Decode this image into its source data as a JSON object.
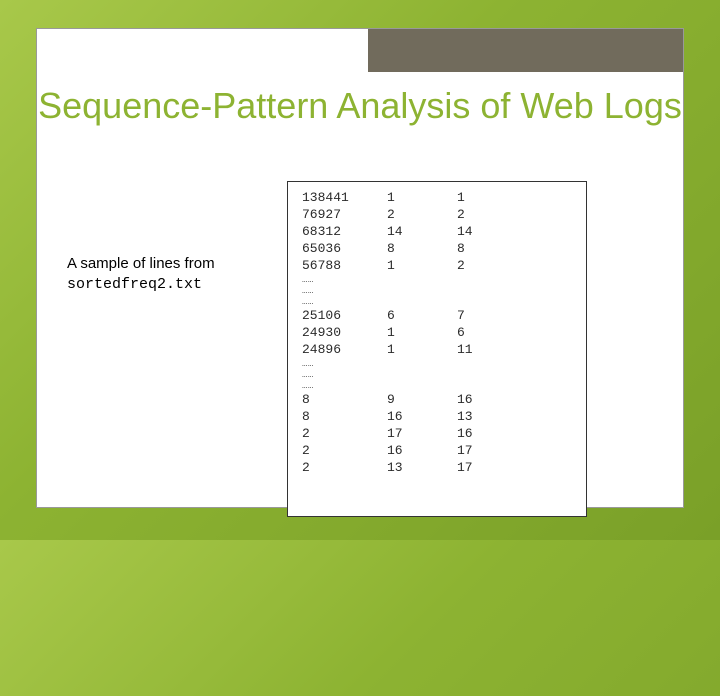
{
  "title": "Sequence-Pattern Analysis of Web Logs",
  "caption_line1": "A sample of lines from",
  "caption_filename": "sortedfreq2.txt",
  "ellipsis": "……",
  "rows_top": [
    {
      "a": "138441",
      "b": "1",
      "c": "1"
    },
    {
      "a": "76927",
      "b": "2",
      "c": "2"
    },
    {
      "a": "68312",
      "b": "14",
      "c": "14"
    },
    {
      "a": "65036",
      "b": "8",
      "c": "8"
    },
    {
      "a": "56788",
      "b": "1",
      "c": "2"
    }
  ],
  "rows_mid": [
    {
      "a": "25106",
      "b": "6",
      "c": "7"
    },
    {
      "a": "24930",
      "b": "1",
      "c": "6"
    },
    {
      "a": "24896",
      "b": "1",
      "c": "11"
    }
  ],
  "rows_bot": [
    {
      "a": "8",
      "b": "9",
      "c": "16"
    },
    {
      "a": "8",
      "b": "16",
      "c": "13"
    },
    {
      "a": "2",
      "b": "17",
      "c": "16"
    },
    {
      "a": "2",
      "b": "16",
      "c": "17"
    },
    {
      "a": "2",
      "b": "13",
      "c": "17"
    }
  ]
}
